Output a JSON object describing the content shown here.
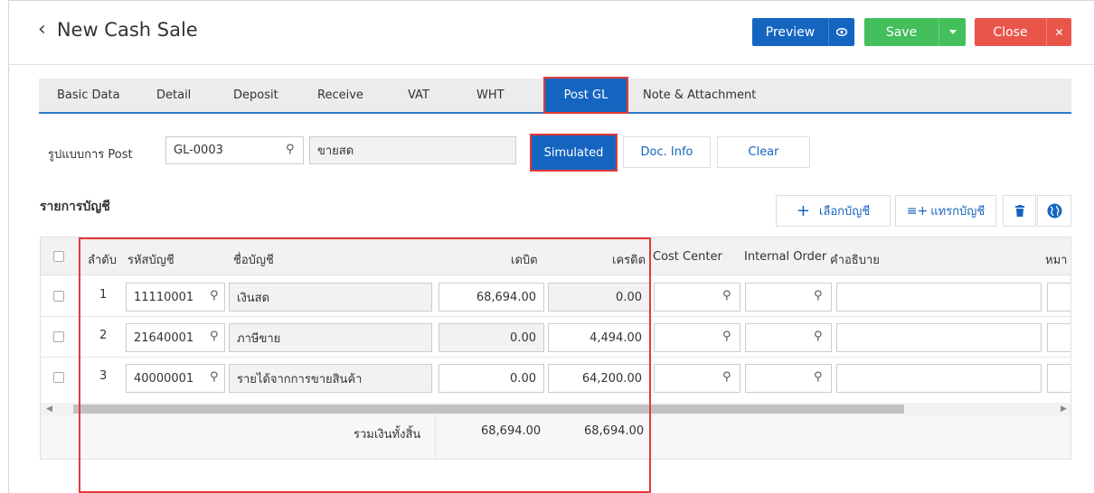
{
  "header": {
    "back_icon": "chevron-left-icon",
    "title": "New Cash Sale",
    "preview_label": "Preview",
    "save_label": "Save",
    "close_label": "Close"
  },
  "tabs": [
    "Basic Data",
    "Detail",
    "Deposit",
    "Receive",
    "VAT",
    "WHT",
    "Post GL",
    "Note & Attachment"
  ],
  "active_tab": "Post GL",
  "post": {
    "label": "รูปแบบการ Post",
    "code": "GL-0003",
    "name": "ขายสด",
    "simulated_label": "Simulated",
    "docinfo_label": "Doc. Info",
    "clear_label": "Clear"
  },
  "accounts_section": {
    "title": "รายการบัญชี",
    "select_label": "เลือกบัญชี",
    "insert_label": "แทรกบัญชี"
  },
  "table": {
    "headers": {
      "seq": "ลำดับ",
      "code": "รหัสบัญชี",
      "name": "ชื่อบัญชี",
      "debit": "เดบิต",
      "credit": "เครดิต",
      "cost_center": "Cost Center",
      "internal_order": "Internal Order",
      "description": "คำอธิบาย",
      "note": "หมา"
    },
    "rows": [
      {
        "seq": "1",
        "code": "11110001",
        "name": "เงินสด",
        "debit": "68,694.00",
        "credit": "0.00"
      },
      {
        "seq": "2",
        "code": "21640001",
        "name": "ภาษีขาย",
        "debit": "0.00",
        "credit": "4,494.00"
      },
      {
        "seq": "3",
        "code": "40000001",
        "name": "รายได้จากการขายสินค้า",
        "debit": "0.00",
        "credit": "64,200.00"
      }
    ],
    "footer": {
      "total_label": "รวมเงินทั้งสิ้น",
      "total_debit": "68,694.00",
      "total_credit": "68,694.00"
    }
  },
  "colors": {
    "primary": "#1565c0",
    "success": "#43bf5b",
    "danger": "#e9544b",
    "highlight": "#e53935"
  }
}
